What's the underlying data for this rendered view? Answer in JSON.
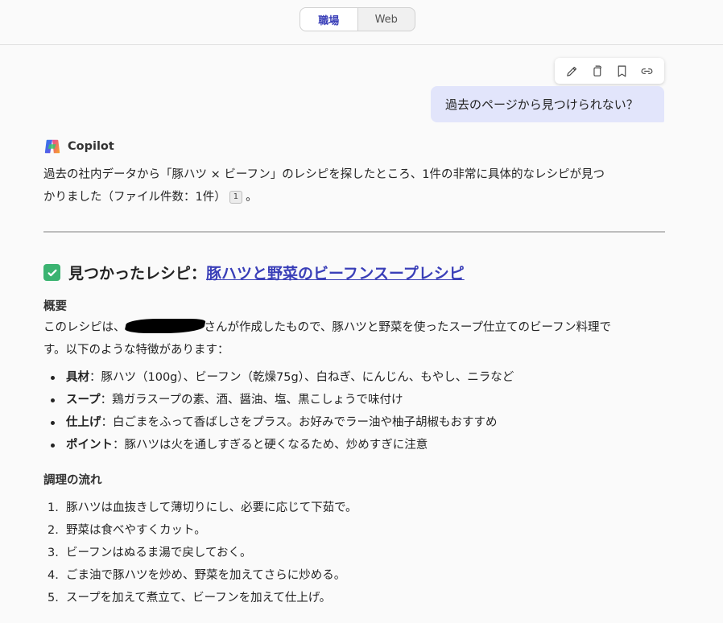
{
  "tabs": [
    {
      "label": "職場",
      "active": true
    },
    {
      "label": "Web",
      "active": false
    }
  ],
  "message_actions": [
    "edit-icon",
    "copy-icon",
    "bookmark-icon",
    "link-icon"
  ],
  "user_message": "過去のページから見つけられない？",
  "assistant": {
    "name": "Copilot",
    "intro": "過去の社内データから「豚ハツ × ビーフン」のレシピを探したところ、1件の非常に具体的なレシピが見つ",
    "intro_line2": "かりました（ファイル件数：1件）",
    "citation": "1",
    "intro_end": "。",
    "heading_prefix": "見つかったレシピ：",
    "heading_link": "豚ハツと野菜のビーフンスープレシピ",
    "overview_title": "概要",
    "overview_pre": "このレシピは、",
    "overview_post": "さんが作成したもので、豚ハツと野菜を使ったスープ仕立てのビーフン料理で",
    "overview_line2": "す。以下のような特徴があります：",
    "features": [
      {
        "label": "具材",
        "text": "：豚ハツ（100g）、ビーフン（乾燥75g）、白ねぎ、にんじん、もやし、ニラなど"
      },
      {
        "label": "スープ",
        "text": "：鶏ガラスープの素、酒、醤油、塩、黒こしょうで味付け"
      },
      {
        "label": "仕上げ",
        "text": "：白ごまをふって香ばしさをプラス。お好みでラー油や柚子胡椒もおすすめ"
      },
      {
        "label": "ポイント",
        "text": "：豚ハツは火を通しすぎると硬くなるため、炒めすぎに注意"
      }
    ],
    "steps_title": "調理の流れ",
    "steps": [
      {
        "num": "1.",
        "text": "豚ハツは血抜きして薄切りにし、必要に応じて下茹で。"
      },
      {
        "num": "2.",
        "text": "野菜は食べやすくカット。"
      },
      {
        "num": "3.",
        "text": "ビーフンはぬるま湯で戻しておく。"
      },
      {
        "num": "4.",
        "text": "ごま油で豚ハツを炒め、野菜を加えてさらに炒める。"
      },
      {
        "num": "5.",
        "text": "スープを加えて煮立て、ビーフンを加えて仕上げ。"
      }
    ]
  },
  "colors": {
    "accent": "#3a3fb8",
    "user_bubble": "#e2e5fb",
    "check": "#3bb371"
  }
}
